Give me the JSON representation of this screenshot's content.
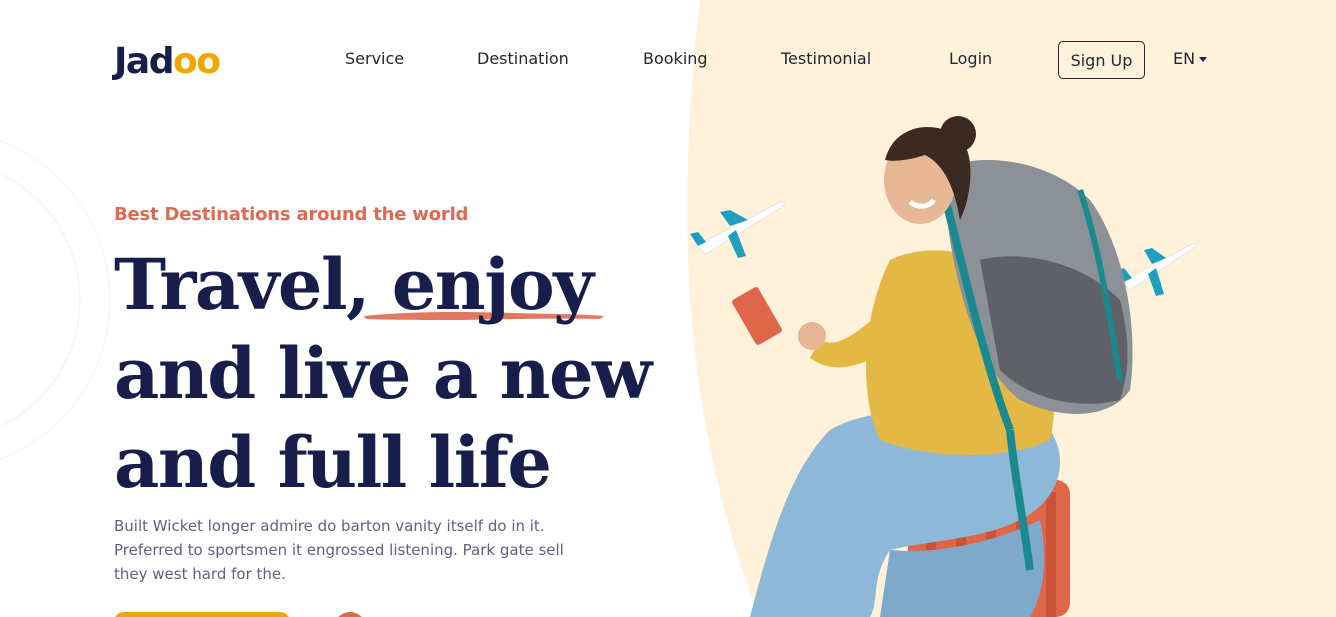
{
  "brand": {
    "logo_prefix": "Jad",
    "logo_suffix": "oo"
  },
  "nav": {
    "items": [
      "Service",
      "Destination",
      "Booking",
      "Testimonial",
      "Login"
    ],
    "signup_label": "Sign Up",
    "language": "EN"
  },
  "hero": {
    "tagline": "Best Destinations around the world",
    "headline_line1": "Travel, enjoy",
    "headline_line2": "and live a new",
    "headline_line3": "and full life",
    "description": "Built Wicket longer admire do barton vanity itself do in it. Preferred to sportsmen it engrossed listening. Park gate sell they west hard for the."
  },
  "colors": {
    "accent_orange": "#DF6951",
    "accent_yellow": "#F1A501",
    "heading_navy": "#181E4B",
    "body_text": "#5E6282",
    "blob_cream": "#FFF1DA"
  },
  "icons": [
    "airplane-icon",
    "chevron-down-icon",
    "play-icon"
  ]
}
